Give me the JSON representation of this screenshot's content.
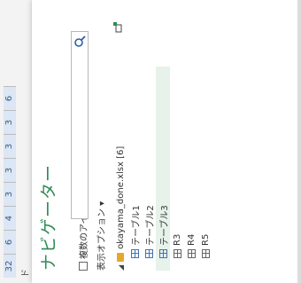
{
  "panel": {
    "title": "ナビゲーター"
  },
  "options": {
    "multi_select_label": "複数のアイテムの選択",
    "display_options_label": "表示オプション",
    "display_options_caret": "▾"
  },
  "tree": {
    "file": {
      "label": "okayama_done.xlsx [6]"
    },
    "items": [
      {
        "type": "table",
        "label": "テーブル1"
      },
      {
        "type": "table",
        "label": "テーブル2"
      },
      {
        "type": "table",
        "label": "テーブル3",
        "selected": true
      },
      {
        "type": "range",
        "label": "R3"
      },
      {
        "type": "range",
        "label": "R4"
      },
      {
        "type": "range",
        "label": "R5"
      }
    ]
  },
  "sheet": {
    "cells": [
      "32",
      "6",
      "4",
      "3",
      "3",
      "3",
      "3",
      "6"
    ],
    "row_label": "ド"
  },
  "icons": {
    "search": "search-icon",
    "new_query": "new-query-icon",
    "folder": "folder-icon",
    "table": "table-icon",
    "range": "range-icon"
  },
  "colors": {
    "title": "#2e8b57",
    "selection": "#e6f2ea",
    "table_icon": "#3f73b7"
  }
}
